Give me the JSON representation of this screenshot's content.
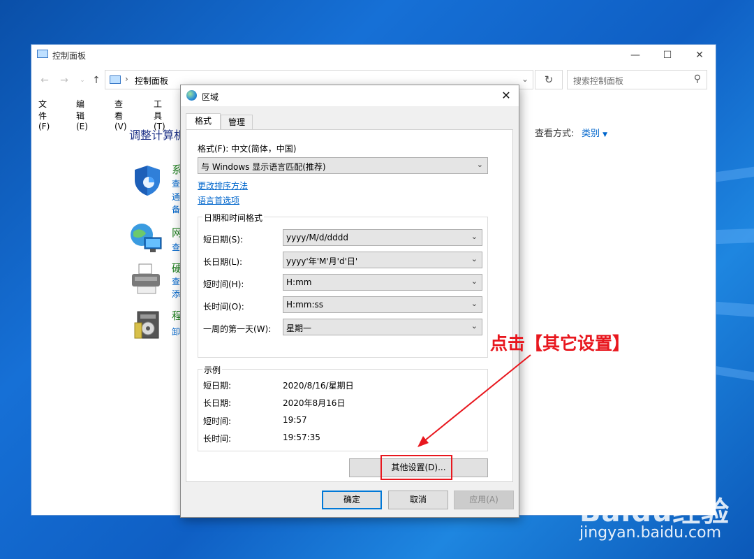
{
  "control_panel": {
    "title": "控制面板",
    "address": "控制面板",
    "search_placeholder": "搜索控制面板",
    "menu": [
      "文件(F)",
      "编辑(E)",
      "查看(V)",
      "工具(T)"
    ],
    "heading": "调整计算机",
    "view_by_label": "查看方式:",
    "view_by_value": "类别",
    "categories": [
      {
        "title": "系",
        "links": [
          "查",
          "通",
          "备"
        ]
      },
      {
        "title": "网",
        "links": [
          "查"
        ]
      },
      {
        "title": "硬",
        "links": [
          "查",
          "添"
        ]
      },
      {
        "title": "程",
        "links": [
          "卸"
        ]
      }
    ]
  },
  "dialog": {
    "title": "区域",
    "tabs": [
      "格式",
      "管理"
    ],
    "format_label": "格式(F): 中文(简体，中国)",
    "format_value": "与 Windows 显示语言匹配(推荐)",
    "links": [
      "更改排序方法",
      "语言首选项"
    ],
    "datetime_group": "日期和时间格式",
    "datetime_rows": [
      {
        "label": "短日期(S):",
        "value": "yyyy/M/d/dddd"
      },
      {
        "label": "长日期(L):",
        "value": "yyyy'年'M'月'd'日'"
      },
      {
        "label": "短时间(H):",
        "value": "H:mm"
      },
      {
        "label": "长时间(O):",
        "value": "H:mm:ss"
      },
      {
        "label": "一周的第一天(W):",
        "value": "星期一"
      }
    ],
    "example_group": "示例",
    "examples": [
      {
        "label": "短日期:",
        "value": "2020/8/16/星期日"
      },
      {
        "label": "长日期:",
        "value": "2020年8月16日"
      },
      {
        "label": "短时间:",
        "value": "19:57"
      },
      {
        "label": "长时间:",
        "value": "19:57:35"
      }
    ],
    "other_settings": "其他设置(D)...",
    "ok": "确定",
    "cancel": "取消",
    "apply": "应用(A)"
  },
  "annotation": {
    "text": "点击【其它设置】",
    "color": "#e8171e"
  },
  "watermark": {
    "logo": "Baidu经验",
    "url": "jingyan.baidu.com"
  }
}
